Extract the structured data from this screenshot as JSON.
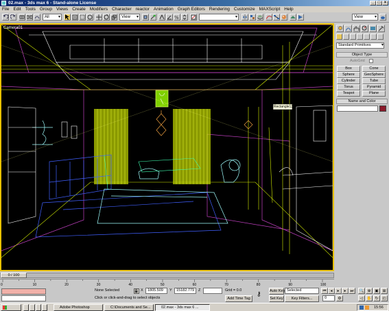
{
  "window": {
    "title": "02.max - 3ds max 6 - Stand-alone License"
  },
  "menu": [
    "File",
    "Edit",
    "Tools",
    "Group",
    "Views",
    "Create",
    "Modifiers",
    "Character",
    "reactor",
    "Animation",
    "Graph Editors",
    "Rendering",
    "Customize",
    "MAXScript",
    "Help"
  ],
  "toolbar": {
    "selection_filter": "All",
    "ref_coord": "View",
    "named_selection": "",
    "right_view": "View"
  },
  "viewport": {
    "label": "Camera01",
    "tooltip": "Rectangle13"
  },
  "command_panel": {
    "primitive_type": "Standard Primitives",
    "object_type_title": "Object Type",
    "autogrid_label": "AutoGrid",
    "buttons": [
      "Box",
      "Cone",
      "Sphere",
      "GeoSphere",
      "Cylinder",
      "Tube",
      "Torus",
      "Pyramid",
      "Teapot",
      "Plane"
    ],
    "name_color_title": "Name and Color",
    "object_color": "#8b1a2b"
  },
  "time": {
    "frame_display": "0 / 100",
    "ticks": [
      "0",
      "10",
      "20",
      "30",
      "40",
      "50",
      "60",
      "70",
      "80",
      "90",
      "100"
    ]
  },
  "status": {
    "selection": "None Selected",
    "prompt": "Click or click-and-drag to select objects",
    "x_value": "1805.509",
    "y_value": "15182.779",
    "z_value": "",
    "grid": "Grid = 0.0",
    "add_time_tag": "Add Time Tag",
    "auto_key": "Auto Key",
    "set_key": "Set Key",
    "key_mode": "Selected",
    "key_filters": "Key Filters...",
    "frame_field": "0"
  },
  "taskbar": {
    "start": "",
    "tasks": [
      "Adobe Photoshop",
      "C:\\Documents and Se...",
      "02.max - 3ds max 6 ..."
    ],
    "clock": "15:56"
  },
  "colors": {
    "accent": "#e8c000",
    "wire_yellow": "#d7f000",
    "wire_blue": "#4060ff",
    "wire_cyan": "#a0ffff",
    "wire_magenta": "#c040c0",
    "wire_white": "#ffffff"
  }
}
